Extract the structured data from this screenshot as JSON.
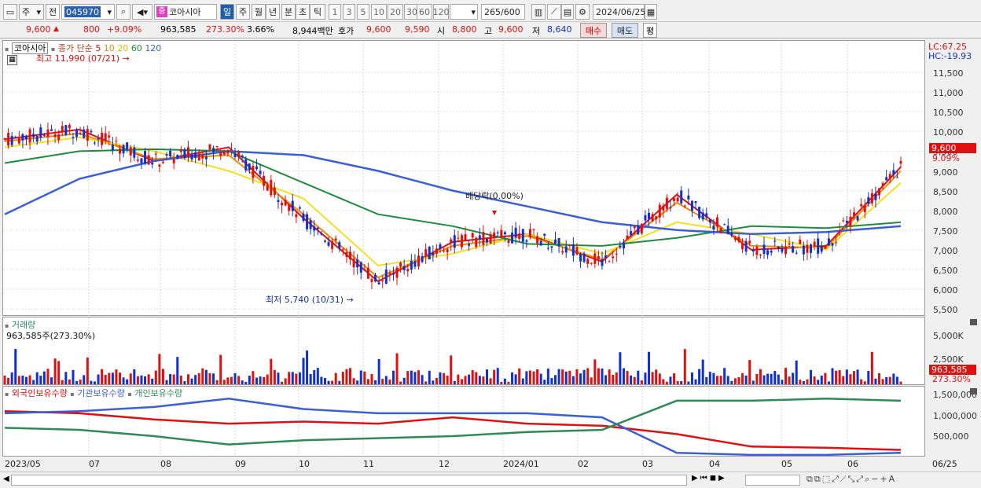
{
  "toolbar": {
    "market": "주",
    "prev": "전",
    "code": "045970",
    "stock_name": "코아시아",
    "stock_badge": "증",
    "periods": [
      "일",
      "주",
      "월",
      "년",
      "분",
      "초",
      "틱"
    ],
    "intervals": [
      "1",
      "3",
      "5",
      "10",
      "20",
      "30",
      "60",
      "120"
    ],
    "count": "265",
    "count_total": "/600",
    "date": "2024/06/25"
  },
  "quote": {
    "price": "9,600",
    "change": "800",
    "change_pct": "+9.09%",
    "volume": "963,585",
    "vol_ratio": "273.30%",
    "turnover": "3.66%",
    "amount": "8,944백만",
    "ask_label": "호가",
    "ask": "9,600",
    "bid": "9,590",
    "open_label": "시",
    "open": "8,800",
    "high_label": "고",
    "high": "9,600",
    "low_label": "저",
    "low": "8,640",
    "buy_btn": "매수",
    "sell_btn": "매도",
    "eval_btn": "평"
  },
  "price_panel": {
    "legend_name": "코아시아",
    "legend_ma": "종가 단순",
    "ma_periods": [
      "5",
      "10",
      "20",
      "60",
      "120"
    ],
    "ma_colors": [
      "#e01010",
      "#f08c00",
      "#f5e020",
      "#1e8c3c",
      "#3a5fd8"
    ],
    "lc": "LC:67.25",
    "hc": "HC:-19.93",
    "high_note": "최고 11,990 (07/21)",
    "low_note": "최저 5,740 (10/31)",
    "dividend_note": "배당락(0.00%)",
    "y_ticks": [
      "11,500",
      "11,000",
      "10,500",
      "10,000",
      "9,500",
      "9,000",
      "8,500",
      "8,000",
      "7,500",
      "7,000",
      "6,500",
      "6,000",
      "5,500"
    ],
    "last_price": "9,600",
    "last_pct": "9.09%"
  },
  "volume_panel": {
    "title": "거래량",
    "value": "963,585주(273.30%)",
    "y_ticks": [
      "5,000K",
      "2,500K"
    ],
    "last_value": "963,585",
    "last_pct": "273.30%"
  },
  "holdings_panel": {
    "legend": [
      "외국인보유수량",
      "기관보유수량",
      "개인보유수량"
    ],
    "colors": [
      "#e01010",
      "#3a5fd8",
      "#2e8b57"
    ],
    "y_ticks": [
      "1,500,000",
      "1,000,000",
      "500,000"
    ]
  },
  "x_labels": [
    "2023/05",
    "07",
    "08",
    "09",
    "10",
    "11",
    "12",
    "2024/01",
    "02",
    "03",
    "04",
    "05",
    "06"
  ],
  "x_end": "06/25",
  "chart_data": {
    "type": "line",
    "title": "",
    "x": [
      "2023/05",
      "07",
      "08",
      "09",
      "10",
      "11",
      "12",
      "2024/01",
      "02",
      "03",
      "04",
      "05",
      "06"
    ],
    "ylim": [
      5500,
      11800
    ],
    "series": [
      {
        "name": "5",
        "values": [
          9800,
          10050,
          9250,
          9600,
          7800,
          6200,
          7200,
          7400,
          6700,
          8400,
          7000,
          7100,
          9100
        ]
      },
      {
        "name": "10",
        "values": [
          9750,
          9950,
          9300,
          9400,
          7900,
          6300,
          7100,
          7350,
          6750,
          8200,
          7100,
          7050,
          9000
        ]
      },
      {
        "name": "20",
        "values": [
          9600,
          9850,
          9500,
          9000,
          8300,
          6600,
          6900,
          7400,
          6900,
          7700,
          7400,
          7000,
          8700
        ]
      },
      {
        "name": "60",
        "values": [
          9200,
          9500,
          9550,
          9500,
          8700,
          7900,
          7600,
          7150,
          7100,
          7300,
          7600,
          7550,
          7700
        ]
      },
      {
        "name": "120",
        "values": [
          7900,
          8800,
          9250,
          9500,
          9400,
          9000,
          8500,
          8100,
          7700,
          7500,
          7400,
          7450,
          7600
        ]
      }
    ]
  }
}
